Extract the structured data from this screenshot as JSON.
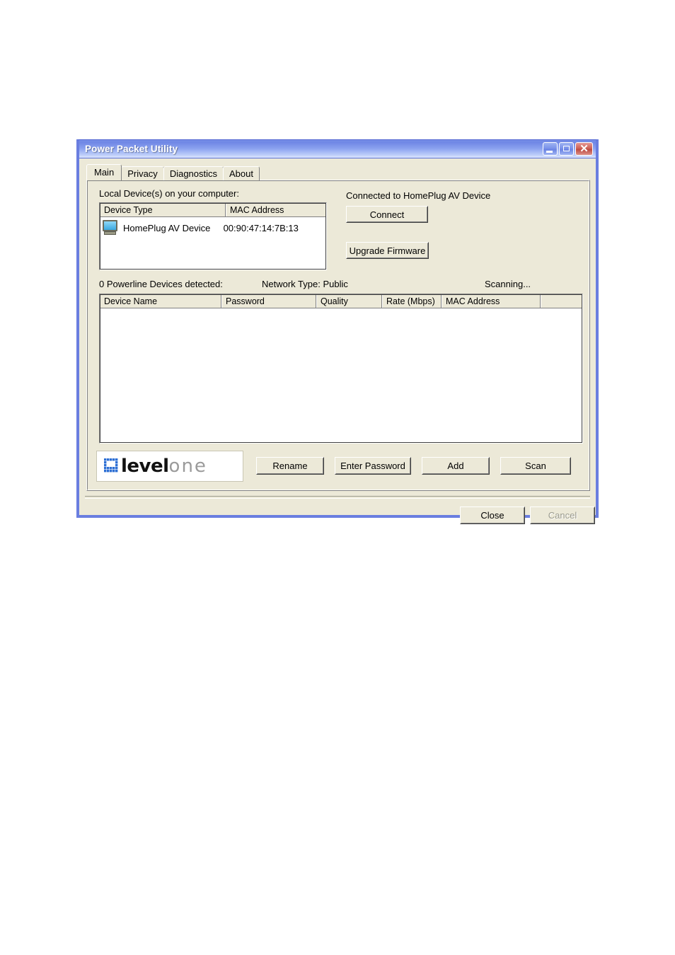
{
  "window": {
    "title": "Power Packet Utility",
    "controls": {
      "minimize": "minimize-button",
      "maximize": "maximize-button",
      "close": "close-button",
      "close_glyph": "✕"
    }
  },
  "tabs": [
    {
      "label": "Main",
      "active": true
    },
    {
      "label": "Privacy",
      "active": false
    },
    {
      "label": "Diagnostics",
      "active": false
    },
    {
      "label": "About",
      "active": false
    }
  ],
  "main": {
    "local_section_label": "Local Device(s) on your computer:",
    "local_list": {
      "columns": [
        "Device Type",
        "MAC Address"
      ],
      "rows": [
        {
          "device_type": "HomePlug AV Device",
          "mac_address": "00:90:47:14:7B:13",
          "icon": "computer-icon"
        }
      ]
    },
    "connection": {
      "status_text": "Connected to HomePlug AV Device",
      "connect_label": "Connect",
      "upgrade_label": "Upgrade Firmware"
    },
    "status": {
      "detected": "0 Powerline Devices detected:",
      "network_type": "Network Type: Public",
      "scanning": "Scanning..."
    },
    "network_list": {
      "columns": [
        "Device Name",
        "Password",
        "Quality",
        "Rate (Mbps)",
        "MAC Address",
        ""
      ],
      "rows": []
    },
    "logo": {
      "brand_bold": "level",
      "brand_light": "one"
    },
    "actions": [
      {
        "label": "Rename",
        "enabled": true
      },
      {
        "label": "Enter Password",
        "enabled": true
      },
      {
        "label": "Add",
        "enabled": true
      },
      {
        "label": "Scan",
        "enabled": true
      }
    ]
  },
  "footer": {
    "close_label": "Close",
    "cancel_label": "Cancel",
    "cancel_enabled": false
  },
  "colors": {
    "title_bar_blue": "#7b92e8",
    "window_frame": "#6a7ee0",
    "dialog_face": "#ece9d8",
    "list_background": "#ffffff",
    "logo_blue": "#2d6fd4",
    "logo_gray": "#9b9b9b",
    "disabled_text": "#9a9a8c"
  }
}
